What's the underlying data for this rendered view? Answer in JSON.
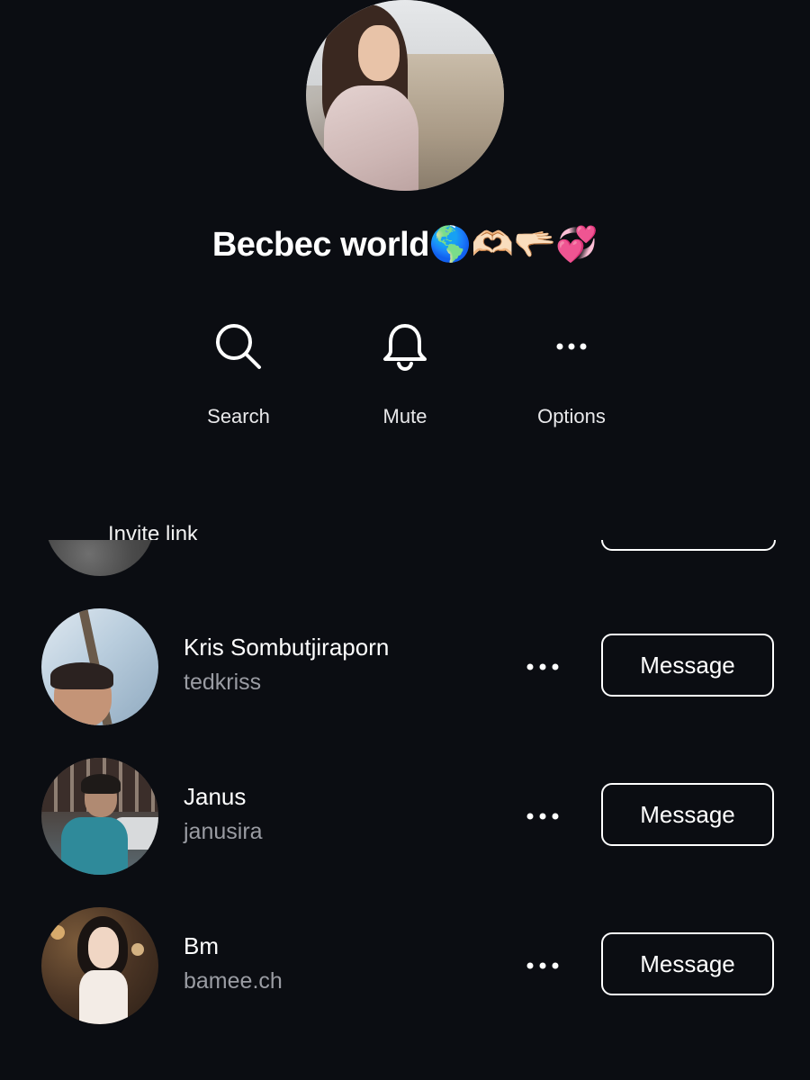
{
  "channel": {
    "title": "Becbec world🌎🫶🏻🫳🏻💞"
  },
  "actions": {
    "search": {
      "label": "Search",
      "icon": "search-icon"
    },
    "mute": {
      "label": "Mute",
      "icon": "bell-icon"
    },
    "options": {
      "label": "Options",
      "icon": "more-horizontal-icon"
    }
  },
  "partial_row": {
    "label": "Invite link"
  },
  "members": [
    {
      "name": "Kris Sombutjiraporn",
      "handle": "tedkriss",
      "button_label": "Message"
    },
    {
      "name": "Janus",
      "handle": "janusira",
      "button_label": "Message"
    },
    {
      "name": "Bm",
      "handle": "bamee.ch",
      "button_label": "Message"
    }
  ],
  "colors": {
    "background": "#0b0d12",
    "text_primary": "#ffffff",
    "text_secondary": "#9a9ca3"
  }
}
